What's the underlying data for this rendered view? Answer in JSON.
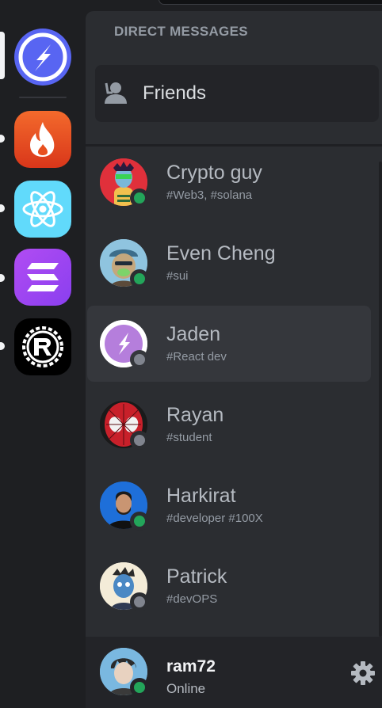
{
  "sidebar": {
    "servers": [
      {
        "name": "home",
        "icon": "bolt-icon",
        "color": "#5865f2"
      },
      {
        "name": "fire",
        "icon": "flame-icon",
        "color": "#e8501f"
      },
      {
        "name": "react",
        "icon": "react-icon",
        "color": "#61dafb"
      },
      {
        "name": "solana",
        "icon": "solana-icon",
        "color": "#9945ff"
      },
      {
        "name": "rust",
        "icon": "rust-icon",
        "color": "#000000"
      }
    ]
  },
  "panel": {
    "header": "DIRECT MESSAGES",
    "friends_label": "Friends"
  },
  "dms": [
    {
      "name": "Crypto guy",
      "sub": "#Web3, #solana",
      "status": "online"
    },
    {
      "name": "Even Cheng",
      "sub": "#sui",
      "status": "online"
    },
    {
      "name": "Jaden",
      "sub": "#React dev",
      "status": "offline",
      "active": true
    },
    {
      "name": "Rayan",
      "sub": "#student",
      "status": "offline"
    },
    {
      "name": "Harkirat",
      "sub": "#developer #100X",
      "status": "online"
    },
    {
      "name": "Patrick",
      "sub": "#devOPS",
      "status": "offline"
    }
  ],
  "user": {
    "name": "ram72",
    "status_text": "Online"
  },
  "colors": {
    "online": "#23a55a",
    "offline": "#80848e",
    "accent": "#5865f2"
  }
}
